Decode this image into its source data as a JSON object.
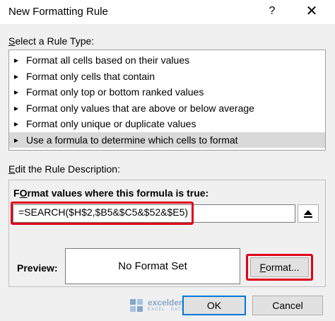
{
  "dialog": {
    "title": "New Formatting Rule",
    "help_glyph": "?",
    "close_glyph": "✕"
  },
  "rule_type": {
    "label_accel": "S",
    "label_rest": "elect a Rule Type:",
    "items": [
      {
        "label": "Format all cells based on their values",
        "selected": false
      },
      {
        "label": "Format only cells that contain",
        "selected": false
      },
      {
        "label": "Format only top or bottom ranked values",
        "selected": false
      },
      {
        "label": "Format only values that are above or below average",
        "selected": false
      },
      {
        "label": "Format only unique or duplicate values",
        "selected": false
      },
      {
        "label": "Use a formula to determine which cells to format",
        "selected": true
      }
    ]
  },
  "description": {
    "label_accel": "E",
    "label_rest": "dit the Rule Description:",
    "formula_label_accel": "O",
    "formula_label_pre": "F",
    "formula_label_rest": "rmat values where this formula is true:",
    "formula_value": "=SEARCH($H$2,$B5&$C5&$52&$E5)",
    "preview_label": "Preview:",
    "preview_text": "No Format Set",
    "format_button_accel": "F",
    "format_button_rest": "ormat..."
  },
  "buttons": {
    "ok": "OK",
    "cancel": "Cancel"
  },
  "watermark": {
    "name": "exceldemy",
    "tagline": "EXCEL · DATA · BI"
  },
  "colors": {
    "highlight": "#e0001b",
    "default_button_border": "#0078d7",
    "selected_row": "#d9d9d9"
  }
}
